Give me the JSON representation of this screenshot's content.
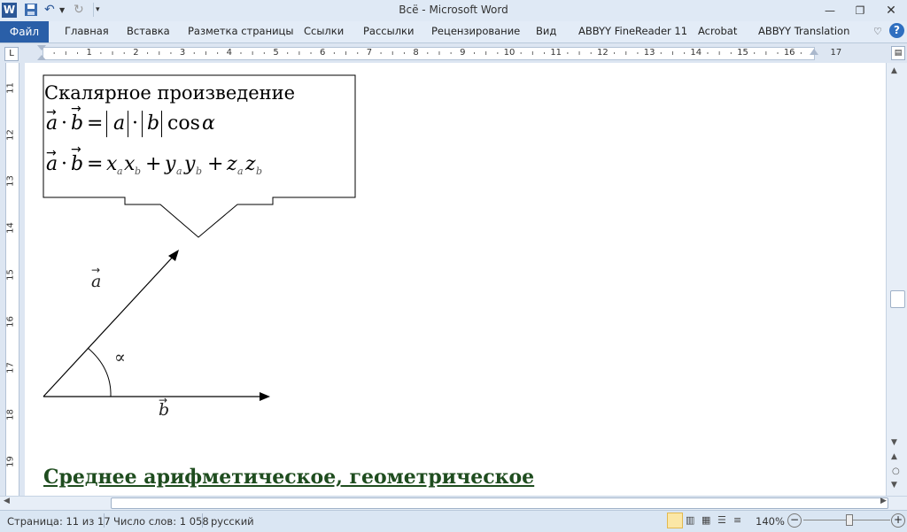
{
  "window": {
    "title": "Всё  -  Microsoft Word"
  },
  "tabs": {
    "file": "Файл",
    "items": [
      "Главная",
      "Вставка",
      "Разметка страницы",
      "Ссылки",
      "Рассылки",
      "Рецензирование",
      "Вид",
      "ABBYY FineReader 11",
      "Acrobat",
      "ABBYY Translation"
    ]
  },
  "ruler": {
    "h_numbers": [
      "1",
      "2",
      "3",
      "4",
      "5",
      "6",
      "7",
      "8",
      "9",
      "10",
      "11",
      "12",
      "13",
      "14",
      "15",
      "16",
      "17"
    ],
    "v_numbers": [
      "11",
      "12",
      "13",
      "14",
      "15",
      "16",
      "17",
      "18",
      "19"
    ]
  },
  "document": {
    "callout_title": "Скалярное произведение",
    "formula1": {
      "a": "a",
      "b": "b",
      "dot": "·",
      "eq": "=",
      "abs_a": "a",
      "abs_b": "b",
      "cos": "cos",
      "alpha": "α"
    },
    "formula2": {
      "x": "x",
      "y": "y",
      "z": "z",
      "sub_a": "a",
      "sub_b": "b",
      "plus": "+"
    },
    "vector_a": "a",
    "vector_b": "b",
    "angle_symbol": "∝",
    "heading": "Среднее арифметическое, геометрическое"
  },
  "statusbar": {
    "page": "Страница: 11 из 17",
    "words": "Число слов: 1 058",
    "language": "русский",
    "zoom": "140%"
  },
  "colors": {
    "file_tab": "#2a5fa8",
    "heading": "#1f4d1f",
    "ribbon": "#e3ecf7"
  }
}
